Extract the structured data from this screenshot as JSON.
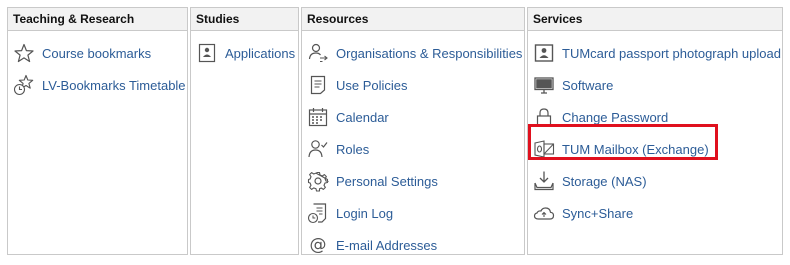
{
  "columns": [
    {
      "title": "Teaching & Research",
      "items": [
        {
          "label": "Course bookmarks",
          "icon": "star-icon"
        },
        {
          "label": "LV-Bookmarks Timetable",
          "icon": "star-clock-icon"
        }
      ]
    },
    {
      "title": "Studies",
      "items": [
        {
          "label": "Applications",
          "icon": "id-card-icon"
        }
      ]
    },
    {
      "title": "Resources",
      "items": [
        {
          "label": "Organisations & Responsibilities",
          "icon": "user-transfer-icon"
        },
        {
          "label": "Use Policies",
          "icon": "document-icon"
        },
        {
          "label": "Calendar",
          "icon": "calendar-icon"
        },
        {
          "label": "Roles",
          "icon": "user-check-icon"
        },
        {
          "label": "Personal Settings",
          "icon": "gear-icon"
        },
        {
          "label": "Login Log",
          "icon": "log-document-icon"
        },
        {
          "label": "E-mail Addresses",
          "icon": "at-icon"
        }
      ]
    },
    {
      "title": "Services",
      "items": [
        {
          "label": "TUMcard passport photograph upload",
          "icon": "photo-id-icon"
        },
        {
          "label": "Software",
          "icon": "monitor-icon"
        },
        {
          "label": "Change Password",
          "icon": "lock-icon"
        },
        {
          "label": "TUM Mailbox (Exchange)",
          "icon": "exchange-mail-icon"
        },
        {
          "label": "Storage (NAS)",
          "icon": "storage-download-icon"
        },
        {
          "label": "Sync+Share",
          "icon": "cloud-upload-icon"
        }
      ]
    }
  ],
  "colors": {
    "link": "#2c5c97",
    "highlight": "#e0101e",
    "header_bg": "#f2f2f2",
    "border": "#c9c9c9"
  }
}
